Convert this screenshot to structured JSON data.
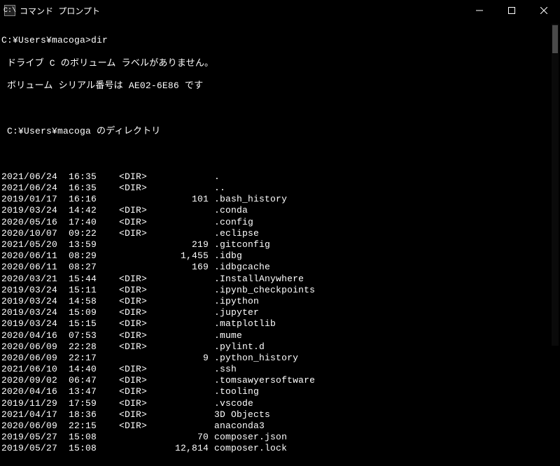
{
  "titlebar": {
    "icon_label": "C:\\",
    "title": "コマンド プロンプト"
  },
  "prompt": {
    "path": "C:¥Users¥macoga>",
    "command": "dir"
  },
  "header": {
    "volume_line": " ドライブ C のボリューム ラベルがありません。",
    "serial_line": " ボリューム シリアル番号は AE02-6E86 です",
    "directory_line": " C:¥Users¥macoga のディレクトリ"
  },
  "listing": [
    {
      "date": "2021/06/24",
      "time": "16:35",
      "dir": "<DIR>",
      "size": "",
      "name": "."
    },
    {
      "date": "2021/06/24",
      "time": "16:35",
      "dir": "<DIR>",
      "size": "",
      "name": ".."
    },
    {
      "date": "2019/01/17",
      "time": "16:16",
      "dir": "",
      "size": "101",
      "name": ".bash_history"
    },
    {
      "date": "2019/03/24",
      "time": "14:42",
      "dir": "<DIR>",
      "size": "",
      "name": ".conda"
    },
    {
      "date": "2020/05/16",
      "time": "17:40",
      "dir": "<DIR>",
      "size": "",
      "name": ".config"
    },
    {
      "date": "2020/10/07",
      "time": "09:22",
      "dir": "<DIR>",
      "size": "",
      "name": ".eclipse"
    },
    {
      "date": "2021/05/20",
      "time": "13:59",
      "dir": "",
      "size": "219",
      "name": ".gitconfig"
    },
    {
      "date": "2020/06/11",
      "time": "08:29",
      "dir": "",
      "size": "1,455",
      "name": ".idbg"
    },
    {
      "date": "2020/06/11",
      "time": "08:27",
      "dir": "",
      "size": "169",
      "name": ".idbgcache"
    },
    {
      "date": "2020/03/21",
      "time": "15:44",
      "dir": "<DIR>",
      "size": "",
      "name": ".InstallAnywhere"
    },
    {
      "date": "2019/03/24",
      "time": "15:11",
      "dir": "<DIR>",
      "size": "",
      "name": ".ipynb_checkpoints"
    },
    {
      "date": "2019/03/24",
      "time": "14:58",
      "dir": "<DIR>",
      "size": "",
      "name": ".ipython"
    },
    {
      "date": "2019/03/24",
      "time": "15:09",
      "dir": "<DIR>",
      "size": "",
      "name": ".jupyter"
    },
    {
      "date": "2019/03/24",
      "time": "15:15",
      "dir": "<DIR>",
      "size": "",
      "name": ".matplotlib"
    },
    {
      "date": "2020/04/16",
      "time": "07:53",
      "dir": "<DIR>",
      "size": "",
      "name": ".mume"
    },
    {
      "date": "2020/06/09",
      "time": "22:28",
      "dir": "<DIR>",
      "size": "",
      "name": ".pylint.d"
    },
    {
      "date": "2020/06/09",
      "time": "22:17",
      "dir": "",
      "size": "9",
      "name": ".python_history"
    },
    {
      "date": "2021/06/10",
      "time": "14:40",
      "dir": "<DIR>",
      "size": "",
      "name": ".ssh"
    },
    {
      "date": "2020/09/02",
      "time": "06:47",
      "dir": "<DIR>",
      "size": "",
      "name": ".tomsawyersoftware"
    },
    {
      "date": "2020/04/16",
      "time": "13:47",
      "dir": "<DIR>",
      "size": "",
      "name": ".tooling"
    },
    {
      "date": "2019/11/29",
      "time": "17:59",
      "dir": "<DIR>",
      "size": "",
      "name": ".vscode"
    },
    {
      "date": "2021/04/17",
      "time": "18:36",
      "dir": "<DIR>",
      "size": "",
      "name": "3D Objects"
    },
    {
      "date": "2020/06/09",
      "time": "22:15",
      "dir": "<DIR>",
      "size": "",
      "name": "anaconda3"
    },
    {
      "date": "2019/05/27",
      "time": "15:08",
      "dir": "",
      "size": "70",
      "name": "composer.json"
    },
    {
      "date": "2019/05/27",
      "time": "15:08",
      "dir": "",
      "size": "12,814",
      "name": "composer.lock"
    }
  ]
}
